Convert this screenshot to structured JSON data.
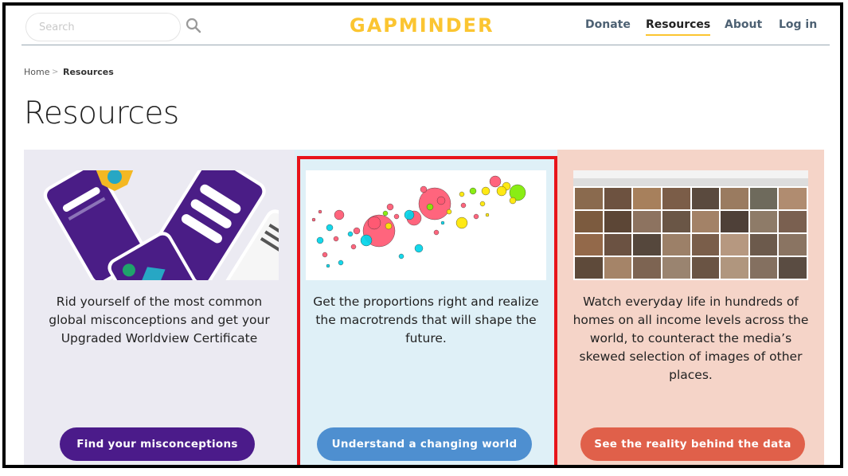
{
  "header": {
    "search_placeholder": "Search",
    "logo_text": "GAPMINDER",
    "nav": [
      "Donate",
      "Resources",
      "About",
      "Log in"
    ],
    "active_nav": "Resources"
  },
  "breadcrumb": {
    "home": "Home",
    "separator": ">",
    "current": "Resources"
  },
  "page": {
    "title": "Resources"
  },
  "cards": [
    {
      "text": "Rid yourself of the most common global misconceptions and get your Upgraded Worldview Certificate",
      "button": "Find your misconceptions",
      "bg_color": "#ebeaf2",
      "button_color": "#4b1b8a"
    },
    {
      "text": "Get the proportions right and realize the macrotrends that will shape the future.",
      "button": "Understand a changing world",
      "bg_color": "#dff0f7",
      "button_color": "#4e8fd0"
    },
    {
      "text": "Watch everyday life in hundreds of homes on all income levels across the world, to counteract the media’s skewed selection of images of other places.",
      "button": "See the reality behind the data",
      "bg_color": "#f5d4c8",
      "button_color": "#e0604a"
    }
  ],
  "colors": {
    "accent_yellow": "#fbc531",
    "highlight_red": "#e8141a",
    "nav_gray": "#4d6173"
  }
}
